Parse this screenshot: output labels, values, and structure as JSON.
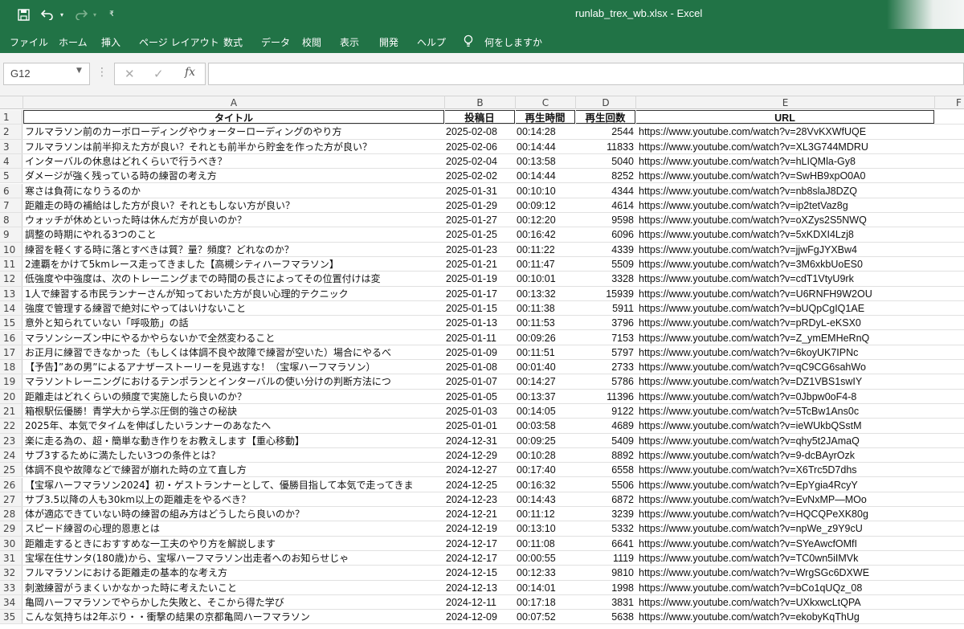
{
  "window": {
    "title": "runlab_trex_wb.xlsx  -  Excel"
  },
  "ribbon": {
    "tabs": [
      "ファイル",
      "ホーム",
      "挿入",
      "ページ レイアウト",
      "数式",
      "データ",
      "校閲",
      "表示",
      "開発",
      "ヘルプ"
    ],
    "tell_me": "何をしますか"
  },
  "formula_bar": {
    "name_box": "G12",
    "fx_label": "fx",
    "content": ""
  },
  "columns": [
    "A",
    "B",
    "C",
    "D",
    "E",
    "F"
  ],
  "header_row": {
    "row_number": "1",
    "a": "タイトル",
    "b": "投稿日",
    "c": "再生時間",
    "d": "再生回数",
    "e": "URL"
  },
  "rows": [
    {
      "n": "2",
      "title": "フルマラソン前のカーボローディングやウォーターローディングのやり方",
      "date": "2025-02-08",
      "time": "00:14:28",
      "views": "2544",
      "url": "https://www.youtube.com/watch?v=28VvKXWfUQE"
    },
    {
      "n": "3",
      "title": "フルマラソンは前半抑えた方が良い？それとも前半から貯金を作った方が良い？",
      "date": "2025-02-06",
      "time": "00:14:44",
      "views": "11833",
      "url": "https://www.youtube.com/watch?v=XL3G744MDRU"
    },
    {
      "n": "4",
      "title": "インターバルの休息はどれくらいで行うべき？",
      "date": "2025-02-04",
      "time": "00:13:58",
      "views": "5040",
      "url": "https://www.youtube.com/watch?v=hLIQMla-Gy8"
    },
    {
      "n": "5",
      "title": "ダメージが強く残っている時の練習の考え方",
      "date": "2025-02-02",
      "time": "00:14:44",
      "views": "8252",
      "url": "https://www.youtube.com/watch?v=SwHB9xpO0A0"
    },
    {
      "n": "6",
      "title": "寒さは負荷になりうるのか",
      "date": "2025-01-31",
      "time": "00:10:10",
      "views": "4344",
      "url": "https://www.youtube.com/watch?v=nb8slaJ8DZQ"
    },
    {
      "n": "7",
      "title": "距離走の時の補給はした方が良い？それともしない方が良い？",
      "date": "2025-01-29",
      "time": "00:09:12",
      "views": "4614",
      "url": "https://www.youtube.com/watch?v=ip2tetVaz8g"
    },
    {
      "n": "8",
      "title": "ウォッチが休めといった時は休んだ方が良いのか？",
      "date": "2025-01-27",
      "time": "00:12:20",
      "views": "9598",
      "url": "https://www.youtube.com/watch?v=oXZys2S5NWQ"
    },
    {
      "n": "9",
      "title": "調整の時期にやれる3つのこと",
      "date": "2025-01-25",
      "time": "00:16:42",
      "views": "6096",
      "url": "https://www.youtube.com/watch?v=5xKDXI4Lzj8"
    },
    {
      "n": "10",
      "title": "練習を軽くする時に落とすべきは質？量？頻度？どれなのか？",
      "date": "2025-01-23",
      "time": "00:11:22",
      "views": "4339",
      "url": "https://www.youtube.com/watch?v=jjwFgJYXBw4"
    },
    {
      "n": "11",
      "title": "2連覇をかけて5kmレース走ってきました【高槻シティハーフマラソン】",
      "date": "2025-01-21",
      "time": "00:11:47",
      "views": "5509",
      "url": "https://www.youtube.com/watch?v=3M6xkbUoES0"
    },
    {
      "n": "12",
      "title": "低強度や中強度は、次のトレーニングまでの時間の長さによってその位置付けは変",
      "date": "2025-01-19",
      "time": "00:10:01",
      "views": "3328",
      "url": "https://www.youtube.com/watch?v=cdT1VtyU9rk"
    },
    {
      "n": "13",
      "title": "1人で練習する市民ランナーさんが知っておいた方が良い心理的テクニック",
      "date": "2025-01-17",
      "time": "00:13:32",
      "views": "15939",
      "url": "https://www.youtube.com/watch?v=U6RNFH9W2OU"
    },
    {
      "n": "14",
      "title": "強度で管理する練習で絶対にやってはいけないこと",
      "date": "2025-01-15",
      "time": "00:11:38",
      "views": "5911",
      "url": "https://www.youtube.com/watch?v=bUQpCgIQ1AE"
    },
    {
      "n": "15",
      "title": "意外と知られていない「呼吸筋」の話",
      "date": "2025-01-13",
      "time": "00:11:53",
      "views": "3796",
      "url": "https://www.youtube.com/watch?v=pRDyL-eKSX0"
    },
    {
      "n": "16",
      "title": "マラソンシーズン中にやるかやらないかで全然変わること",
      "date": "2025-01-11",
      "time": "00:09:26",
      "views": "7153",
      "url": "https://www.youtube.com/watch?v=Z_ymEMHeRnQ"
    },
    {
      "n": "17",
      "title": "お正月に練習できなかった（もしくは体調不良や故障で練習が空いた）場合にやるべ",
      "date": "2025-01-09",
      "time": "00:11:51",
      "views": "5797",
      "url": "https://www.youtube.com/watch?v=6koyUK7IPNc"
    },
    {
      "n": "18",
      "title": "【予告】”あの男”によるアナザーストーリーを見逃すな！（宝塚ハーフマラソン）",
      "date": "2025-01-08",
      "time": "00:01:40",
      "views": "2733",
      "url": "https://www.youtube.com/watch?v=qC9CG6sahWo"
    },
    {
      "n": "19",
      "title": "マラソントレーニングにおけるテンポランとインターバルの使い分けの判断方法につ",
      "date": "2025-01-07",
      "time": "00:14:27",
      "views": "5786",
      "url": "https://www.youtube.com/watch?v=DZ1VBS1swIY"
    },
    {
      "n": "20",
      "title": "距離走はどれくらいの頻度で実施したら良いのか？",
      "date": "2025-01-05",
      "time": "00:13:37",
      "views": "11396",
      "url": "https://www.youtube.com/watch?v=0Jbpw0oF4-8"
    },
    {
      "n": "21",
      "title": "箱根駅伝優勝！青学大から学ぶ圧倒的強さの秘訣",
      "date": "2025-01-03",
      "time": "00:14:05",
      "views": "9122",
      "url": "https://www.youtube.com/watch?v=5TcBw1Ans0c"
    },
    {
      "n": "22",
      "title": "2025年、本気でタイムを伸ばしたいランナーのあなたへ",
      "date": "2025-01-01",
      "time": "00:03:58",
      "views": "4689",
      "url": "https://www.youtube.com/watch?v=ieWUkbQSstM"
    },
    {
      "n": "23",
      "title": "楽に走る為の、超・簡単な動き作りをお教えします【重心移動】",
      "date": "2024-12-31",
      "time": "00:09:25",
      "views": "5409",
      "url": "https://www.youtube.com/watch?v=qhy5t2JAmaQ"
    },
    {
      "n": "24",
      "title": "サブ3するために満たしたい3つの条件とは？",
      "date": "2024-12-29",
      "time": "00:10:28",
      "views": "8892",
      "url": "https://www.youtube.com/watch?v=9-dcBAyrOzk"
    },
    {
      "n": "25",
      "title": "体調不良や故障などで練習が崩れた時の立て直し方",
      "date": "2024-12-27",
      "time": "00:17:40",
      "views": "6558",
      "url": "https://www.youtube.com/watch?v=X6Trc5D7dhs"
    },
    {
      "n": "26",
      "title": "【宝塚ハーフマラソン2024】初・ゲストランナーとして、優勝目指して本気で走ってきま",
      "date": "2024-12-25",
      "time": "00:16:32",
      "views": "5506",
      "url": "https://www.youtube.com/watch?v=EpYgia4RcyY"
    },
    {
      "n": "27",
      "title": "サブ3.5以降の人も30km以上の距離走をやるべき？",
      "date": "2024-12-23",
      "time": "00:14:43",
      "views": "6872",
      "url": "https://www.youtube.com/watch?v=EvNxMP—MOo"
    },
    {
      "n": "28",
      "title": "体が適応できていない時の練習の組み方はどうしたら良いのか？",
      "date": "2024-12-21",
      "time": "00:11:12",
      "views": "3239",
      "url": "https://www.youtube.com/watch?v=HQCQPeXK80g"
    },
    {
      "n": "29",
      "title": "スピード練習の心理的恩恵とは",
      "date": "2024-12-19",
      "time": "00:13:10",
      "views": "5332",
      "url": "https://www.youtube.com/watch?v=npWe_z9Y9cU"
    },
    {
      "n": "30",
      "title": "距離走するときにおすすめな一工夫のやり方を解説します",
      "date": "2024-12-17",
      "time": "00:11:08",
      "views": "6641",
      "url": "https://www.youtube.com/watch?v=SYeAwcfOMfI"
    },
    {
      "n": "31",
      "title": "宝塚在住サンタ(180歳)から、宝塚ハーフマラソン出走者へのお知らせじゃ",
      "date": "2024-12-17",
      "time": "00:00:55",
      "views": "1119",
      "url": "https://www.youtube.com/watch?v=TC0wn5iIMVk"
    },
    {
      "n": "32",
      "title": "フルマラソンにおける距離走の基本的な考え方",
      "date": "2024-12-15",
      "time": "00:12:33",
      "views": "9810",
      "url": "https://www.youtube.com/watch?v=WrgSGc6DXWE"
    },
    {
      "n": "33",
      "title": "刺激練習がうまくいかなかった時に考えたいこと",
      "date": "2024-12-13",
      "time": "00:14:01",
      "views": "1998",
      "url": "https://www.youtube.com/watch?v=bCo1qUQz_08"
    },
    {
      "n": "34",
      "title": "亀岡ハーフマラソンでやらかした失敗と、そこから得た学び",
      "date": "2024-12-11",
      "time": "00:17:18",
      "views": "3831",
      "url": "https://www.youtube.com/watch?v=UXkxwcLtQPA"
    },
    {
      "n": "35",
      "title": "こんな気持ちは2年ぶり・・衝撃の結果の京都亀岡ハーフマラソン",
      "date": "2024-12-09",
      "time": "00:07:52",
      "views": "5638",
      "url": "https://www.youtube.com/watch?v=ekobyKqThUg"
    }
  ]
}
